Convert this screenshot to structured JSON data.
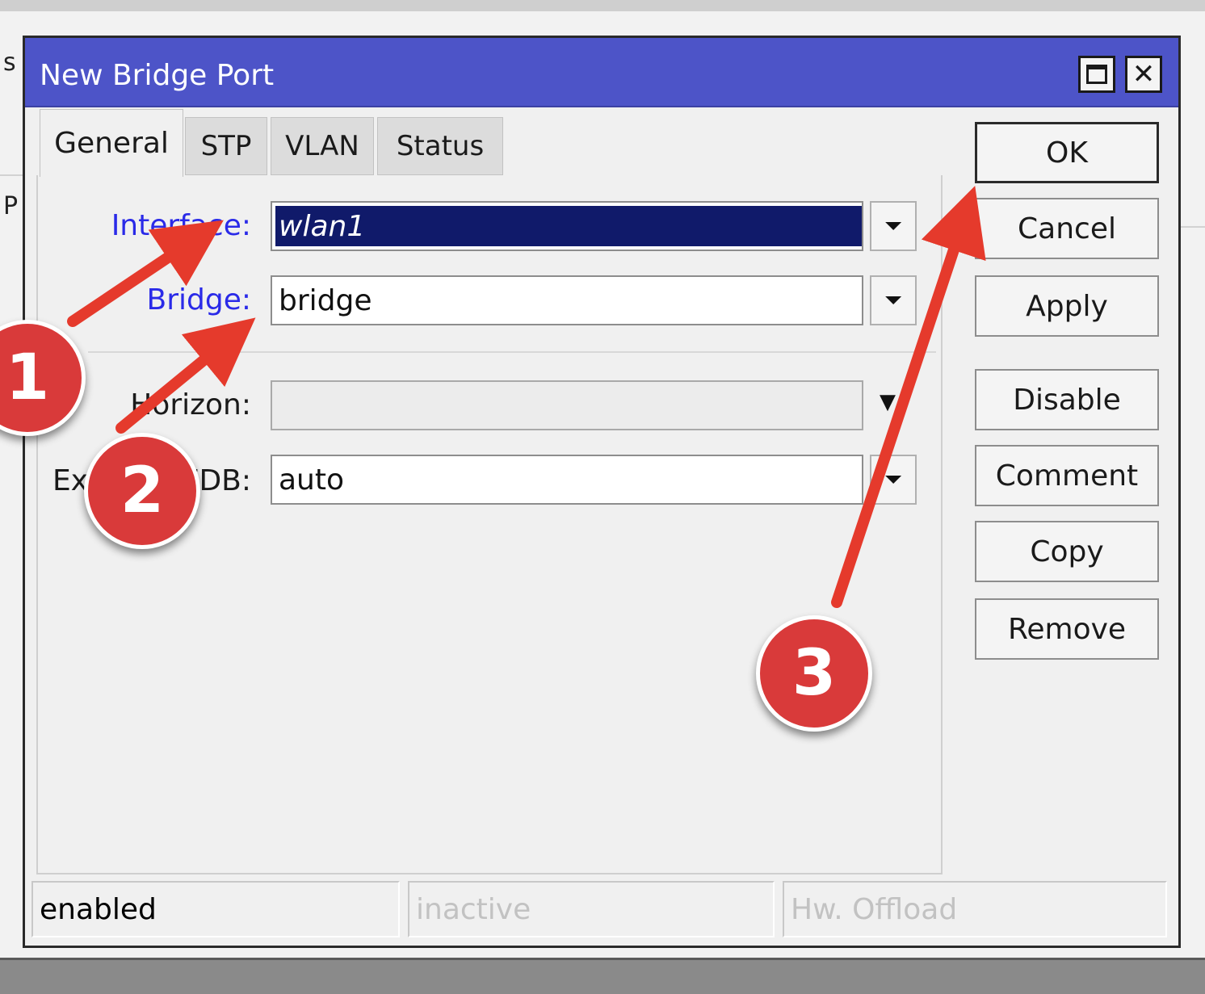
{
  "background": {
    "top_left_text": "s",
    "mid_left_text": "P"
  },
  "window": {
    "title": "New Bridge Port",
    "title_buttons": {
      "maximize": "maximize-icon",
      "close": "close-icon"
    },
    "accent_color": "#4d54c8"
  },
  "tabs": [
    {
      "label": "General",
      "active": true
    },
    {
      "label": "STP",
      "active": false
    },
    {
      "label": "VLAN",
      "active": false
    },
    {
      "label": "Status",
      "active": false
    }
  ],
  "form": {
    "interface": {
      "label": "Interface:",
      "value": "wlan1"
    },
    "bridge": {
      "label": "Bridge:",
      "value": "bridge"
    },
    "horizon": {
      "label": "Horizon:",
      "value": ""
    },
    "external_fdb": {
      "label": "External FDB:",
      "value": "auto"
    }
  },
  "buttons": {
    "ok": "OK",
    "cancel": "Cancel",
    "apply": "Apply",
    "disable": "Disable",
    "comment": "Comment",
    "copy": "Copy",
    "remove": "Remove"
  },
  "status": {
    "state": "enabled",
    "activity": "inactive",
    "hw": "Hw. Offload"
  },
  "annotations": {
    "color": "#e53a2c",
    "badges": [
      "1",
      "2",
      "3"
    ]
  }
}
